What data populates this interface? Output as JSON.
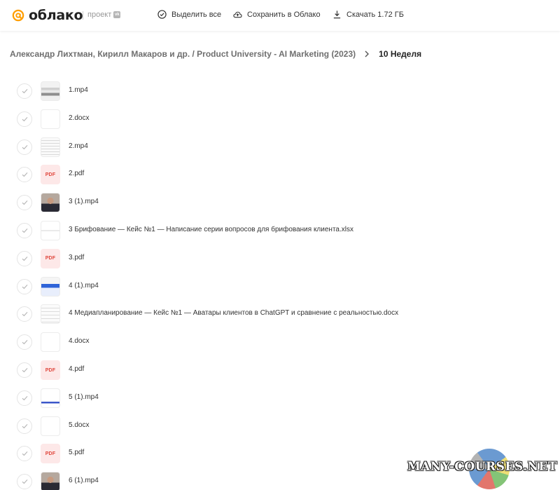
{
  "header": {
    "logo_symbol": "@",
    "logo_word": "облако",
    "project_label": "проект",
    "vk_badge": "vk",
    "actions": [
      {
        "label": "Выделить все",
        "icon": "check-circle-icon"
      },
      {
        "label": "Сохранить в Облако",
        "icon": "cloud-upload-icon"
      },
      {
        "label": "Скачать 1.72 ГБ",
        "icon": "download-icon"
      }
    ]
  },
  "breadcrumb": {
    "path": "Александр Лихтман, Кирилл Макаров и др. / Product University - AI Marketing (2023)",
    "current": "10 Неделя"
  },
  "files": [
    {
      "name": "1.mp4",
      "thumb": "video"
    },
    {
      "name": "2.docx",
      "thumb": "blank"
    },
    {
      "name": "2.mp4",
      "thumb": "sheet"
    },
    {
      "name": "2.pdf",
      "thumb": "pdf"
    },
    {
      "name": "3 (1).mp4",
      "thumb": "person"
    },
    {
      "name": "3 Брифование — Кейс №1 — Написание серии вопросов для брифования клиента.xlsx",
      "thumb": "line"
    },
    {
      "name": "3.pdf",
      "thumb": "pdf"
    },
    {
      "name": "4 (1).mp4",
      "thumb": "blue"
    },
    {
      "name": "4 Медиапланирование — Кейс №1 — Аватары клиентов в ChatGPT и сравнение с реальностью.docx",
      "thumb": "doc"
    },
    {
      "name": "4.docx",
      "thumb": "blank"
    },
    {
      "name": "4.pdf",
      "thumb": "pdf"
    },
    {
      "name": "5 (1).mp4",
      "thumb": "win"
    },
    {
      "name": "5.docx",
      "thumb": "blank"
    },
    {
      "name": "5.pdf",
      "thumb": "pdf"
    },
    {
      "name": "6 (1).mp4",
      "thumb": "person"
    }
  ],
  "pdf_thumb_label": "PDF",
  "watermark": "MANY-COURSES.NET",
  "colors": {
    "brand_orange": "#ff9e00",
    "pdf_red": "#e0463c",
    "pdf_bg": "#fde8e8"
  }
}
